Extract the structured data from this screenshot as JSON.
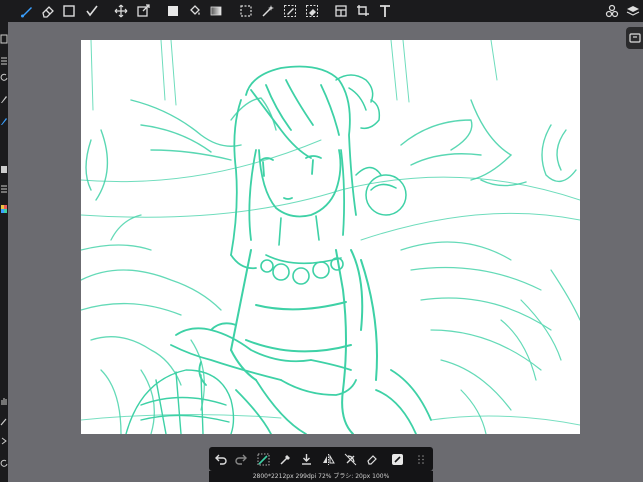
{
  "app": {
    "status_text": "2800*2212px 299dpi 72% ブラシ: 20px 100%"
  },
  "colors": {
    "toolbar_bg": "#1b1b1d",
    "workspace_bg": "#6b6b70",
    "accent_blue": "#3aa0ff",
    "sketch_stroke": "#3ed1a6"
  },
  "toolbar": {
    "tools": [
      {
        "name": "brush",
        "icon": "brush-icon",
        "active": true
      },
      {
        "name": "eraser",
        "icon": "eraser-icon"
      },
      {
        "name": "shape",
        "icon": "rectangle-icon"
      },
      {
        "name": "smudge",
        "icon": "check-icon"
      },
      {
        "name": "move",
        "icon": "move-icon"
      },
      {
        "name": "transform",
        "icon": "transform-icon"
      },
      {
        "name": "fill-color",
        "icon": "color-swatch-icon"
      },
      {
        "name": "bucket",
        "icon": "bucket-icon"
      },
      {
        "name": "gradient",
        "icon": "gradient-icon"
      },
      {
        "name": "select",
        "icon": "marquee-icon"
      },
      {
        "name": "magic-wand",
        "icon": "magic-wand-icon"
      },
      {
        "name": "select-pen",
        "icon": "select-pen-icon"
      },
      {
        "name": "select-eraser",
        "icon": "select-eraser-icon"
      },
      {
        "name": "panel",
        "icon": "panel-icon"
      },
      {
        "name": "crop",
        "icon": "crop-icon"
      },
      {
        "name": "text",
        "icon": "text-icon"
      },
      {
        "name": "materials",
        "icon": "materials-icon"
      },
      {
        "name": "layers",
        "icon": "layers-icon"
      }
    ]
  },
  "bottom_toolbar": {
    "tools": [
      {
        "name": "undo",
        "icon": "undo-icon"
      },
      {
        "name": "redo",
        "icon": "redo-icon"
      },
      {
        "name": "transform-selection",
        "icon": "transform-selection-icon"
      },
      {
        "name": "eyedropper",
        "icon": "eyedropper-icon"
      },
      {
        "name": "save",
        "icon": "download-icon"
      },
      {
        "name": "flip",
        "icon": "flip-icon"
      },
      {
        "name": "snap-off",
        "icon": "snap-off-icon"
      },
      {
        "name": "eraser-toggle",
        "icon": "eraser-toggle-icon"
      },
      {
        "name": "edit",
        "icon": "edit-icon"
      },
      {
        "name": "grid",
        "icon": "grid-icon"
      }
    ]
  }
}
